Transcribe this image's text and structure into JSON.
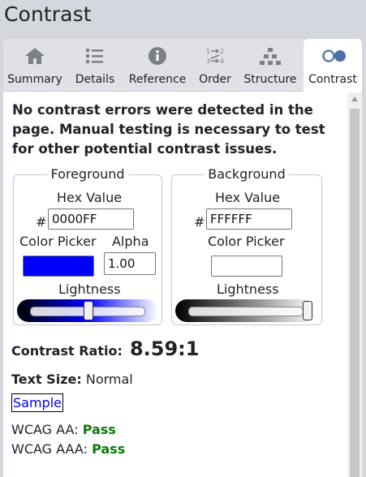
{
  "app_title": "Contrast",
  "tabs": [
    {
      "label": "Summary",
      "icon": "home-icon"
    },
    {
      "label": "Details",
      "icon": "list-icon"
    },
    {
      "label": "Reference",
      "icon": "info-icon"
    },
    {
      "label": "Order",
      "icon": "order-icon"
    },
    {
      "label": "Structure",
      "icon": "structure-icon"
    },
    {
      "label": "Contrast",
      "icon": "contrast-icon"
    }
  ],
  "active_tab": "Contrast",
  "message": "No contrast errors were detected in the page. Manual testing is necessary to test for other potential contrast issues.",
  "foreground": {
    "title": "Foreground",
    "hex_label": "Hex Value",
    "hash": "#",
    "hex_value": "0000FF",
    "color_picker_label": "Color Picker",
    "alpha_label": "Alpha",
    "alpha_value": "1.00",
    "lightness_label": "Lightness",
    "swatch_color": "#0000ff",
    "lightness_level": 0.5
  },
  "background": {
    "title": "Background",
    "hex_label": "Hex Value",
    "hash": "#",
    "hex_value": "FFFFFF",
    "color_picker_label": "Color Picker",
    "lightness_label": "Lightness",
    "swatch_color": "#ffffff",
    "lightness_level": 1.0
  },
  "results": {
    "ratio_label": "Contrast Ratio:",
    "ratio_value": "8.59:1",
    "text_size_label": "Text Size:",
    "text_size_value": "Normal",
    "sample_text": "Sample",
    "wcag_aa_label": "WCAG AA:",
    "wcag_aa_value": "Pass",
    "wcag_aaa_label": "WCAG AAA:",
    "wcag_aaa_value": "Pass"
  },
  "colors": {
    "pass": "#0a7a0a",
    "link": "#1f5fbf"
  }
}
